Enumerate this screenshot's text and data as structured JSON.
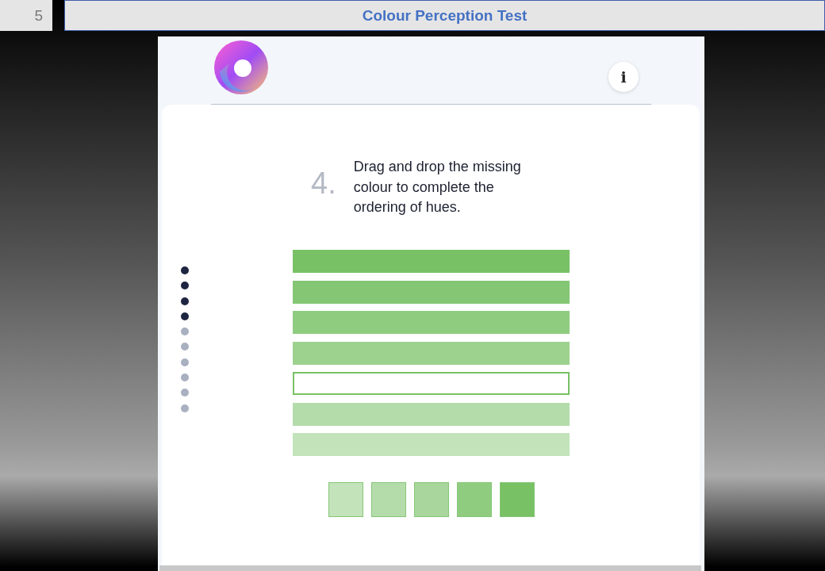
{
  "slide": {
    "number": "5",
    "title": "Colour Perception Test"
  },
  "app": {
    "info_button": "i",
    "question_number": "4.",
    "question": "Drag and drop the missing colour to complete the ordering of hues.",
    "progress": [
      {
        "completed": true
      },
      {
        "completed": true
      },
      {
        "completed": true
      },
      {
        "completed": true
      },
      {
        "completed": false
      },
      {
        "completed": false
      },
      {
        "completed": false
      },
      {
        "completed": false
      },
      {
        "completed": false
      },
      {
        "completed": false
      }
    ],
    "hue_bars": [
      {
        "kind": "filled",
        "color": "#78c165"
      },
      {
        "kind": "filled",
        "color": "#84c674"
      },
      {
        "kind": "filled",
        "color": "#90cc80"
      },
      {
        "kind": "filled",
        "color": "#9dd28e"
      },
      {
        "kind": "empty",
        "color": "#78c165"
      },
      {
        "kind": "filled",
        "color": "#b4dcab"
      },
      {
        "kind": "filled",
        "color": "#c3e3bb"
      }
    ],
    "swatches": [
      {
        "color": "#c3e3bb"
      },
      {
        "color": "#b4dcab"
      },
      {
        "color": "#a8d69d"
      },
      {
        "color": "#90cc80"
      },
      {
        "color": "#78c165"
      }
    ]
  }
}
